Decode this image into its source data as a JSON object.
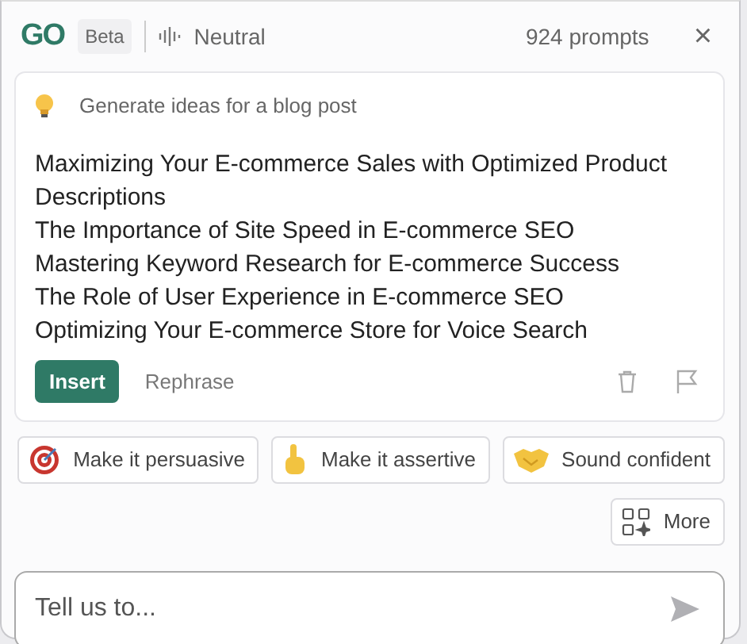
{
  "header": {
    "logo": "GO",
    "badge": "Beta",
    "tone": "Neutral",
    "prompt_count": "924 prompts",
    "close": "×"
  },
  "card": {
    "prompt": "Generate ideas for a blog post",
    "lines": [
      "Maximizing Your E-commerce Sales with Optimized Product Descriptions",
      "The Importance of Site Speed in E-commerce SEO",
      "Mastering Keyword Research for E-commerce Success",
      "The Role of User Experience in E-commerce SEO",
      "Optimizing Your E-commerce Store for Voice Search"
    ],
    "insert": "Insert",
    "rephrase": "Rephrase"
  },
  "suggestions": [
    {
      "kind": "target",
      "label": "Make it persuasive"
    },
    {
      "kind": "finger",
      "label": "Make it assertive"
    },
    {
      "kind": "handshake",
      "label": "Sound confident"
    }
  ],
  "more": "More",
  "input": {
    "placeholder": "Tell us to..."
  }
}
